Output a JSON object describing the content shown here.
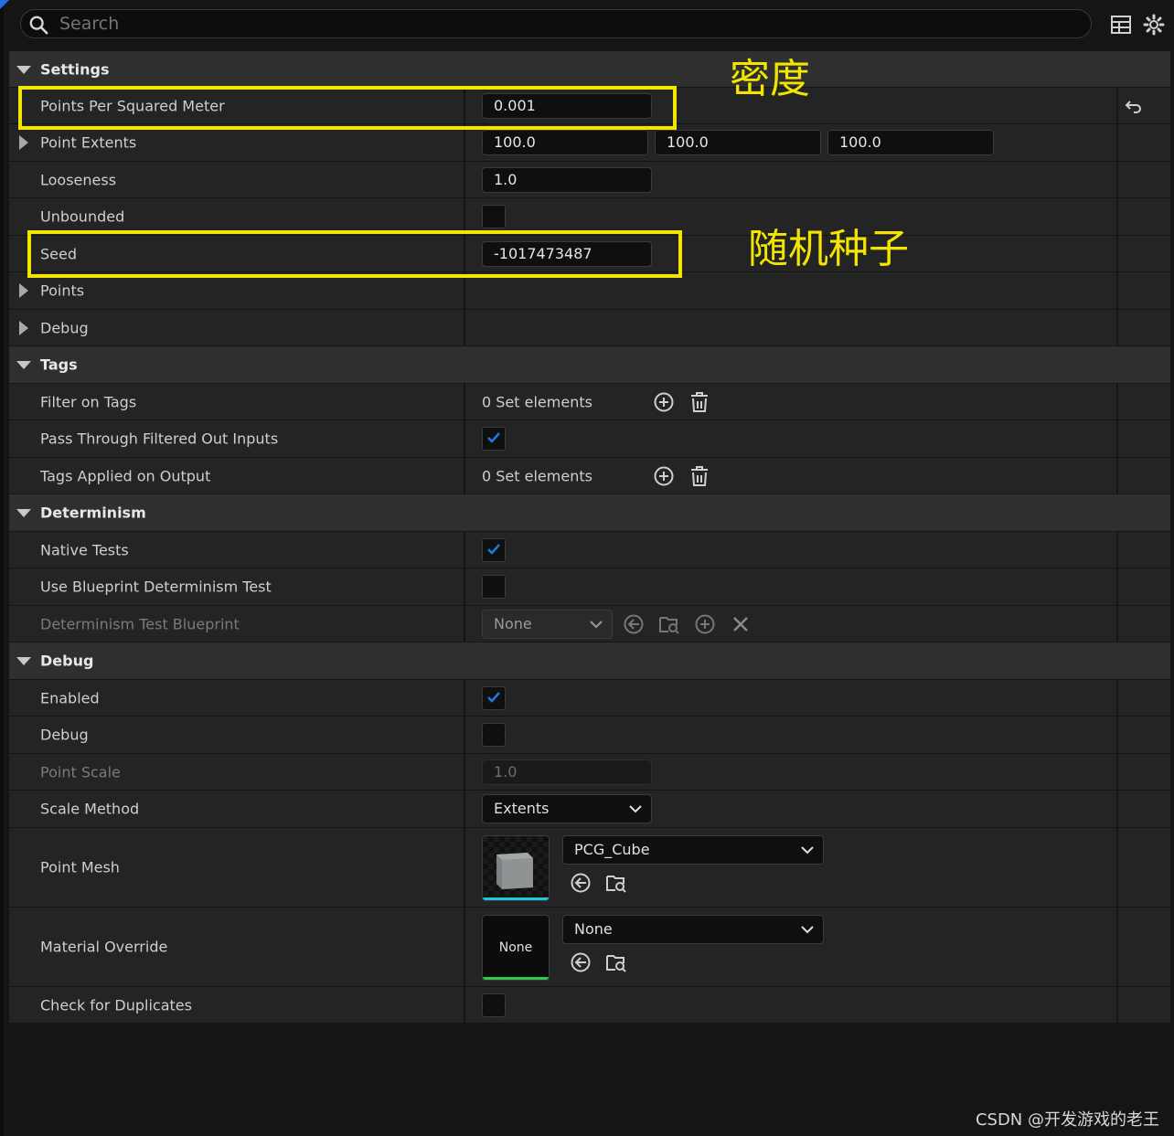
{
  "search": {
    "placeholder": "Search"
  },
  "toolbar": {
    "table_icon": "table-view-icon",
    "settings_icon": "gear-icon"
  },
  "sections": {
    "settings": {
      "title": "Settings",
      "points_per_sq_meter": {
        "label": "Points Per Squared Meter",
        "value": "0.001"
      },
      "point_extents": {
        "label": "Point Extents",
        "x": "100.0",
        "y": "100.0",
        "z": "100.0"
      },
      "looseness": {
        "label": "Looseness",
        "value": "1.0"
      },
      "unbounded": {
        "label": "Unbounded",
        "checked": false
      },
      "seed": {
        "label": "Seed",
        "value": "-1017473487"
      },
      "points": {
        "label": "Points"
      },
      "debug": {
        "label": "Debug"
      }
    },
    "tags": {
      "title": "Tags",
      "filter_on_tags": {
        "label": "Filter on Tags",
        "value": "0 Set elements"
      },
      "pass_through": {
        "label": "Pass Through Filtered Out Inputs",
        "checked": true
      },
      "tags_applied": {
        "label": "Tags Applied on Output",
        "value": "0 Set elements"
      }
    },
    "determinism": {
      "title": "Determinism",
      "native_tests": {
        "label": "Native Tests",
        "checked": true
      },
      "use_blueprint": {
        "label": "Use Blueprint Determinism Test",
        "checked": false
      },
      "test_blueprint": {
        "label": "Determinism Test Blueprint",
        "value": "None"
      }
    },
    "debug": {
      "title": "Debug",
      "enabled": {
        "label": "Enabled",
        "checked": true
      },
      "debug": {
        "label": "Debug",
        "checked": false
      },
      "point_scale": {
        "label": "Point Scale",
        "value": "1.0"
      },
      "scale_method": {
        "label": "Scale Method",
        "value": "Extents"
      },
      "point_mesh": {
        "label": "Point Mesh",
        "value": "PCG_Cube"
      },
      "material_override": {
        "label": "Material Override",
        "value": "None",
        "thumb_label": "None"
      },
      "check_duplicates": {
        "label": "Check for Duplicates",
        "checked": false
      }
    }
  },
  "annotations": {
    "density": "密度",
    "random_seed": "随机种子"
  },
  "watermark": "CSDN @开发游戏的老王",
  "colors": {
    "highlight": "#f2e600",
    "check": "#1f7ae0",
    "accent_cyan": "#1fc8e0",
    "accent_green": "#2ec84a"
  }
}
